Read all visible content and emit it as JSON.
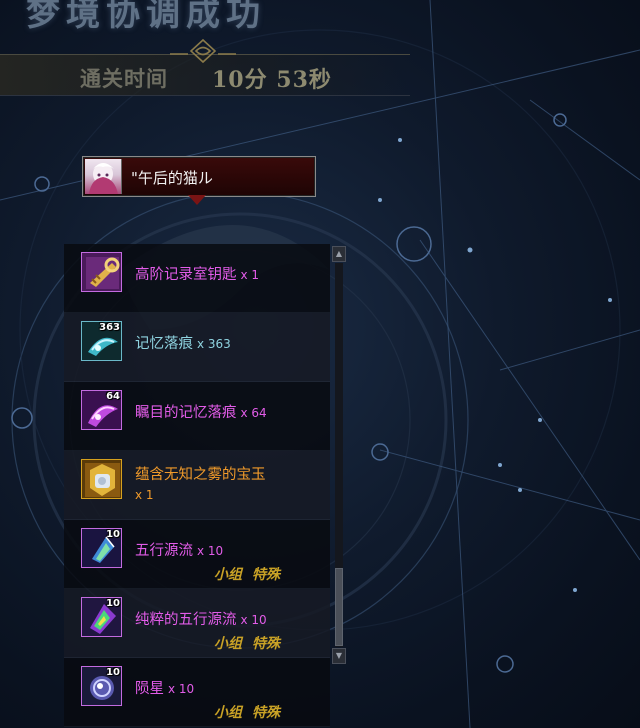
{
  "header": {
    "title": "梦境协调成功",
    "time_label": "通关时间",
    "time_value": "10分 53秒"
  },
  "player": {
    "name": "\"午后的猫ル"
  },
  "rewards": [
    {
      "name": "高阶记录室钥匙",
      "qty": "x 1",
      "icon": "key-item-icon",
      "rarity": "purple",
      "name_color": "#e25ce8",
      "qty_color": "#e25ce8"
    },
    {
      "name": "记忆落痕",
      "qty": "x 363",
      "icon_count": "363",
      "icon": "memory-trace-icon",
      "rarity": "cyan",
      "name_color": "#8fd3e0",
      "qty_color": "#8fd3e0"
    },
    {
      "name": "瞩目的记忆落痕",
      "qty": "x 64",
      "icon_count": "64",
      "icon": "notable-memory-trace-icon",
      "rarity": "purple",
      "name_color": "#e25ce8",
      "qty_color": "#e25ce8"
    },
    {
      "name": "蕴含无知之雾的宝玉",
      "qty": "x 1",
      "icon": "fog-jewel-icon",
      "rarity": "gold",
      "name_color": "#f09a2a",
      "qty_color": "#f09a2a"
    },
    {
      "name": "五行源流",
      "qty": "x 10",
      "icon_count": "10",
      "icon": "five-elements-icon",
      "rarity": "purple",
      "name_color": "#e25ce8",
      "qty_color": "#e25ce8",
      "tags": [
        "小组",
        "特殊"
      ]
    },
    {
      "name": "纯粹的五行源流",
      "qty": "x 10",
      "icon_count": "10",
      "icon": "pure-five-elements-icon",
      "rarity": "purple",
      "name_color": "#e25ce8",
      "qty_color": "#e25ce8",
      "tags": [
        "小组",
        "特殊"
      ]
    },
    {
      "name": "陨星",
      "qty": "x 10",
      "icon_count": "10",
      "icon": "meteor-icon",
      "rarity": "purple",
      "name_color": "#e25ce8",
      "qty_color": "#e25ce8",
      "tags": [
        "小组",
        "特殊"
      ]
    }
  ],
  "colors": {
    "tag_gold": "#c9a226",
    "rarity_purple": "#c36be0",
    "rarity_cyan": "#6ab8c8",
    "rarity_gold": "#d6a11e"
  }
}
